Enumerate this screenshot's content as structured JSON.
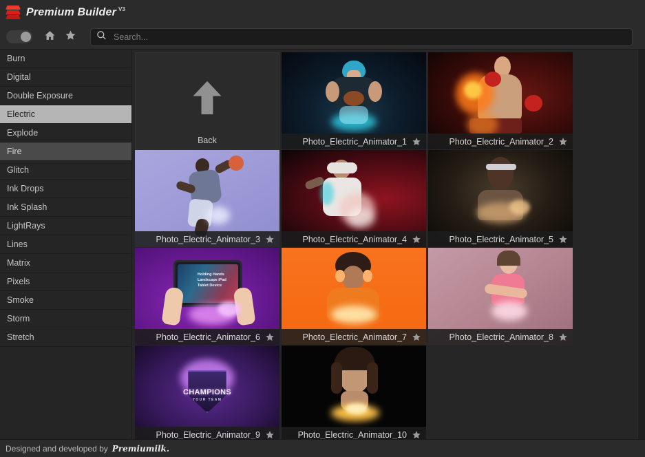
{
  "header": {
    "title": "Premium Builder",
    "version": "V3",
    "logo_icon": "stacked-layers-icon",
    "bg_color": "#2b2b2b",
    "accent_color": "#e02020"
  },
  "toolbar": {
    "toggle": {
      "name": "view-toggle",
      "state": "on"
    },
    "home_icon": "home-icon",
    "favorites_icon": "star-icon",
    "search": {
      "icon": "search-icon",
      "placeholder": "Search...",
      "value": ""
    }
  },
  "sidebar": {
    "selected": "Electric",
    "hovered": "Fire",
    "items": [
      {
        "label": "Burn"
      },
      {
        "label": "Digital"
      },
      {
        "label": "Double Exposure"
      },
      {
        "label": "Electric"
      },
      {
        "label": "Explode"
      },
      {
        "label": "Fire"
      },
      {
        "label": "Glitch"
      },
      {
        "label": "Ink Drops"
      },
      {
        "label": "Ink Splash"
      },
      {
        "label": "LightRays"
      },
      {
        "label": "Lines"
      },
      {
        "label": "Matrix"
      },
      {
        "label": "Pixels"
      },
      {
        "label": "Smoke"
      },
      {
        "label": "Storm"
      },
      {
        "label": "Stretch"
      }
    ]
  },
  "gallery": {
    "back_tile": {
      "label": "Back",
      "icon": "up-arrow-icon"
    },
    "star_icon": "star-icon",
    "items": [
      {
        "label": "Photo_Electric_Animator_1",
        "theme": "t1",
        "art": "football-player-cyan-electric"
      },
      {
        "label": "Photo_Electric_Animator_2",
        "theme": "t2",
        "art": "boxer-fire-red"
      },
      {
        "label": "Photo_Electric_Animator_3",
        "theme": "t3",
        "art": "basketball-dunk-lavender"
      },
      {
        "label": "Photo_Electric_Animator_4",
        "theme": "t4",
        "art": "vr-headset-man-red"
      },
      {
        "label": "Photo_Electric_Animator_5",
        "theme": "t5",
        "art": "man-futuristic-glasses-brown"
      },
      {
        "label": "Photo_Electric_Animator_6",
        "theme": "t6",
        "art": "hands-holding-ipad-purple"
      },
      {
        "label": "Photo_Electric_Animator_7",
        "theme": "t7",
        "art": "woman-headphones-orange"
      },
      {
        "label": "Photo_Electric_Animator_8",
        "theme": "t8",
        "art": "fitness-woman-pink"
      },
      {
        "label": "Photo_Electric_Animator_9",
        "theme": "t9",
        "art": "champions-badge-purple"
      },
      {
        "label": "Photo_Electric_Animator_10",
        "theme": "t10",
        "art": "woman-portrait-gold-glow"
      }
    ],
    "tile_6_screen_text": "Holding Hands Landscape iPad Tablet Device",
    "tile_9_badge_text": "CHAMPIONS",
    "tile_9_badge_sub": "YOUR TEAM"
  },
  "footer": {
    "text": "Designed and developed by",
    "brand": "Premiumilk."
  }
}
